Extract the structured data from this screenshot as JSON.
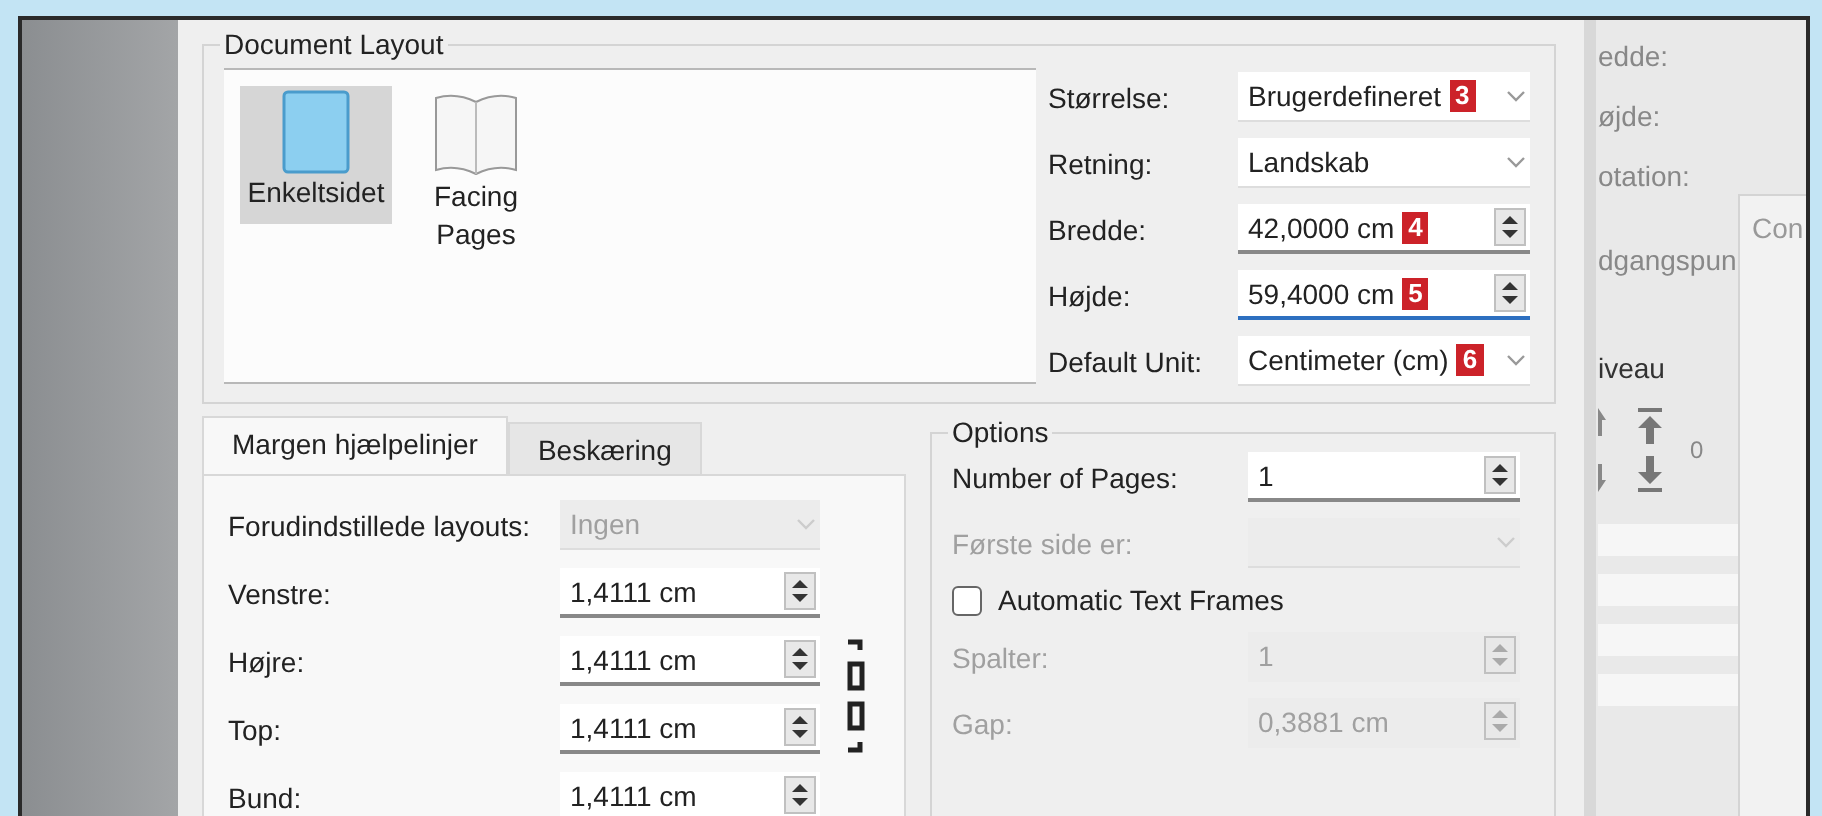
{
  "document_layout": {
    "title": "Document Layout",
    "layouts": [
      {
        "label": "Enkeltsidet",
        "kind": "single",
        "selected": true
      },
      {
        "label": "Facing Pages",
        "kind": "facing",
        "selected": false
      }
    ],
    "fields": [
      {
        "kind": "select",
        "label": "Størrelse:",
        "value": "Brugerdefineret",
        "badge": "3"
      },
      {
        "kind": "select",
        "label": "Retning:",
        "value": "Landskab"
      },
      {
        "kind": "spin",
        "label": "Bredde:",
        "value": "42,0000 cm",
        "badge": "4",
        "focused": false
      },
      {
        "kind": "spin",
        "label": "Højde:",
        "value": "59,4000 cm",
        "badge": "5",
        "focused": true
      },
      {
        "kind": "select",
        "label": "Default Unit:",
        "value": "Centimeter (cm)",
        "badge": "6"
      }
    ]
  },
  "margin_tabs": [
    {
      "label": "Margen hjælpelinjer",
      "selected": true
    },
    {
      "label": "Beskæring",
      "selected": false
    }
  ],
  "margins": {
    "preset": {
      "label": "Forudindstillede layouts:",
      "value": "Ingen",
      "disabled": true
    },
    "fields": [
      {
        "label": "Venstre:",
        "value": "1,4111 cm"
      },
      {
        "label": "Højre:",
        "value": "1,4111 cm"
      },
      {
        "label": "Top:",
        "value": "1,4111 cm"
      },
      {
        "label": "Bund:",
        "value": "1,4111 cm"
      }
    ]
  },
  "options": {
    "title": "Options",
    "fields": [
      {
        "kind": "spin",
        "label": "Number of Pages:",
        "value": "1",
        "disabled": false
      },
      {
        "kind": "select",
        "label": "Første side er:",
        "disabled": true
      },
      {
        "kind": "checkbox",
        "label": "Automatic Text Frames",
        "checked": false
      },
      {
        "kind": "spin",
        "label": "Spalter:",
        "value": "1",
        "disabled": true
      },
      {
        "kind": "spin",
        "label": "Gap:",
        "value": "0,3881 cm",
        "disabled": true
      }
    ]
  },
  "background_panel": {
    "labels": [
      "edde:",
      "øjde:",
      "otation:",
      "dgangspun"
    ],
    "tab": "Con",
    "section": "iveau",
    "value": "0"
  }
}
